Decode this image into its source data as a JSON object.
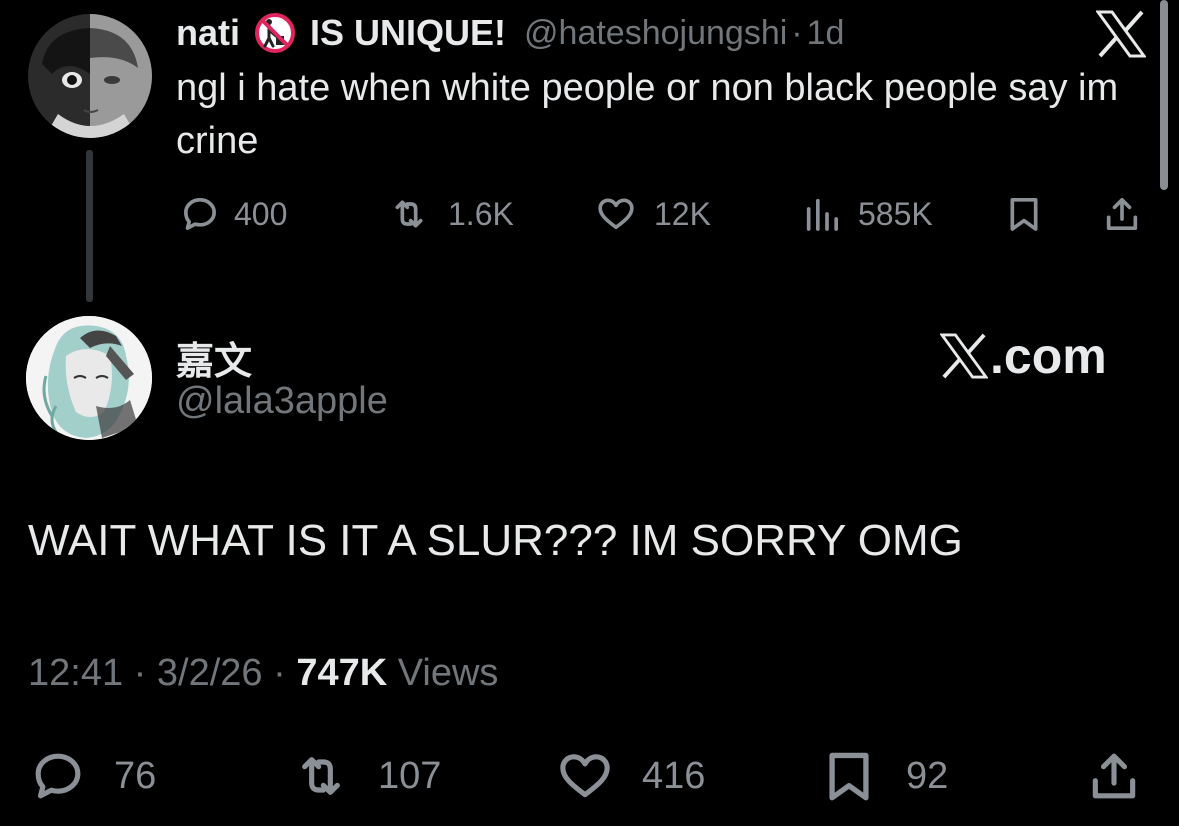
{
  "parent": {
    "name": "nati",
    "name_suffix": "IS UNIQUE!",
    "handle": "@hateshojungshi",
    "separator": "·",
    "time": "1d",
    "text": "ngl i hate when white people or non black people say  im crine",
    "stats": {
      "replies": "400",
      "reposts": "1.6K",
      "likes": "12K",
      "views": "585K"
    }
  },
  "reply": {
    "name": "嘉文",
    "handle": "@lala3apple",
    "brand": ".com",
    "text": "WAIT WHAT IS IT A SLUR??? IM SORRY OMG",
    "time": "12:41",
    "date": "3/2/26",
    "separator": "·",
    "views_count": "747K",
    "views_label": "Views",
    "stats": {
      "replies": "76",
      "reposts": "107",
      "likes": "416",
      "bookmarks": "92"
    }
  },
  "colors": {
    "background": "#000000",
    "text_primary": "#e7e9ea",
    "text_secondary": "#71767b",
    "icon": "#8b9096"
  },
  "icons": [
    "reply-icon",
    "repost-icon",
    "like-icon",
    "views-icon",
    "bookmark-icon",
    "share-icon",
    "x-logo-icon",
    "no-littering-emoji"
  ]
}
